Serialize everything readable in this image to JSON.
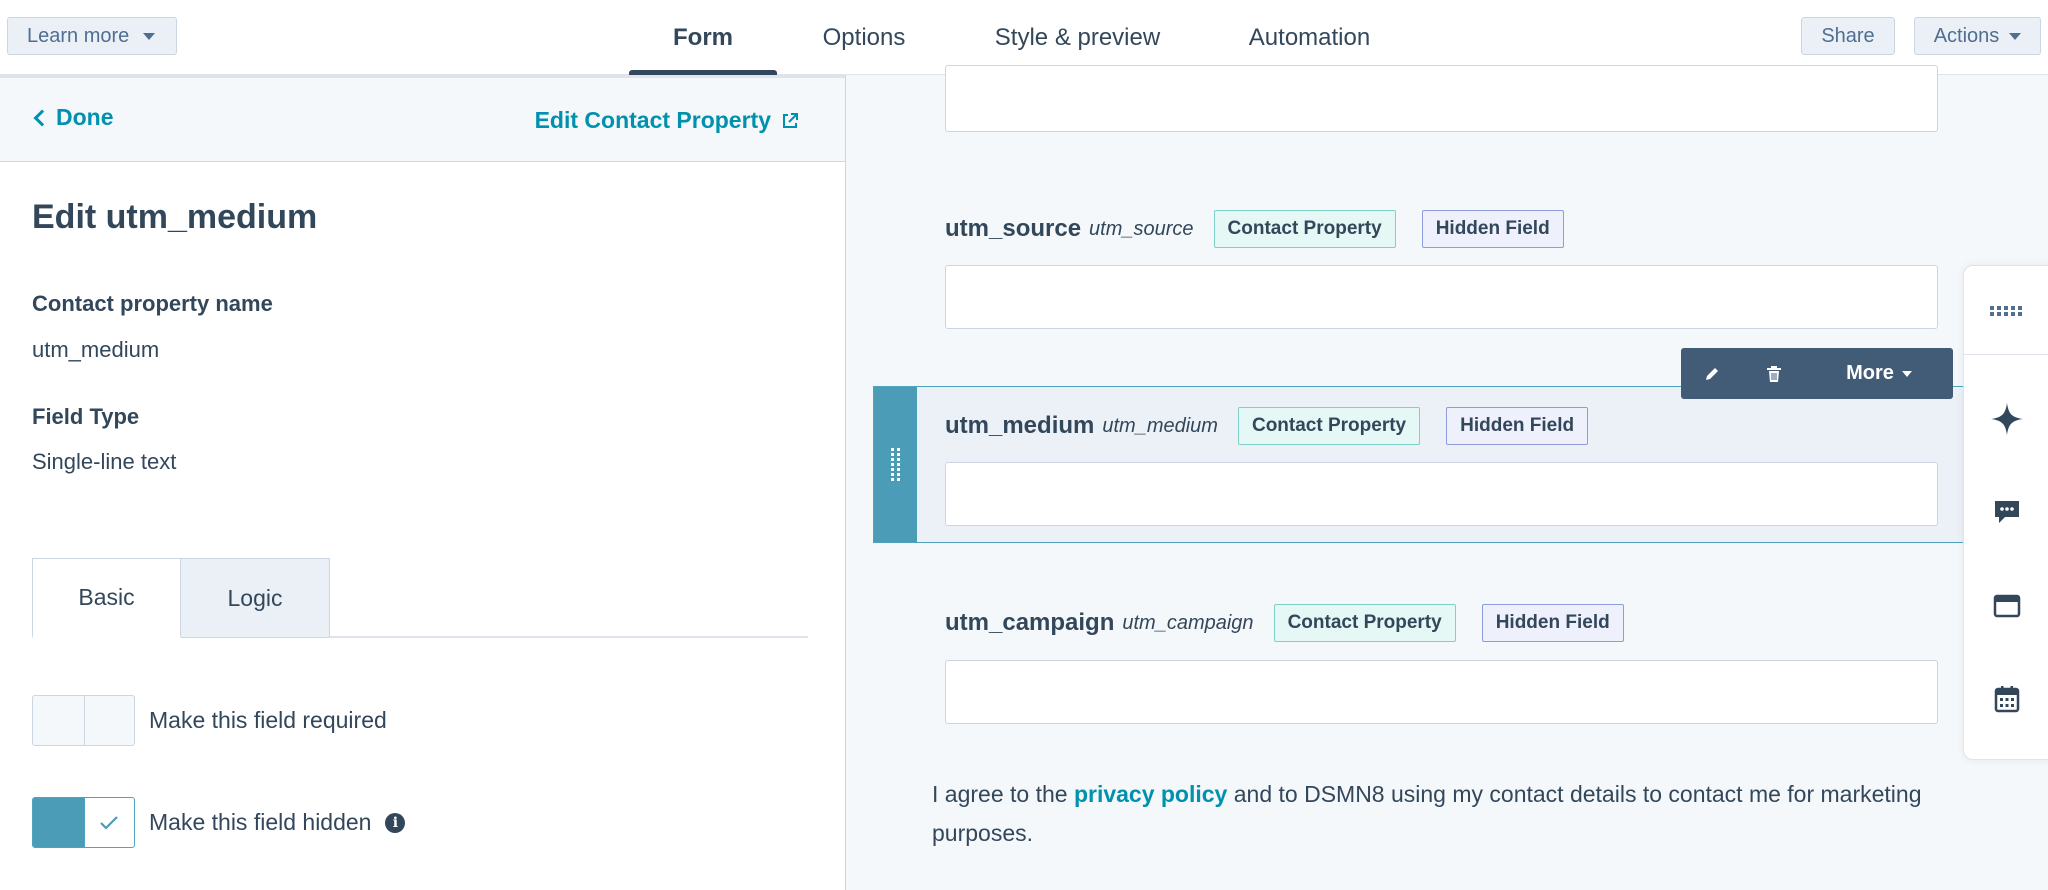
{
  "topbar": {
    "learn_more": "Learn more",
    "tabs": [
      "Form",
      "Options",
      "Style & preview",
      "Automation"
    ],
    "share": "Share",
    "actions": "Actions"
  },
  "panel": {
    "done": "Done",
    "edit_property_link": "Edit Contact Property",
    "title": "Edit utm_medium",
    "contact_property_name_label": "Contact property name",
    "contact_property_name_value": "utm_medium",
    "field_type_label": "Field Type",
    "field_type_value": "Single-line text",
    "tabs": {
      "basic": "Basic",
      "logic": "Logic"
    },
    "toggles": {
      "required_label": "Make this field required",
      "required_on": false,
      "hidden_label": "Make this field hidden",
      "hidden_on": true
    }
  },
  "preview": {
    "fields": [
      {
        "label": "utm_source",
        "internal": "utm_source",
        "badge_contact": "Contact Property",
        "badge_hidden": "Hidden Field"
      },
      {
        "label": "utm_medium",
        "internal": "utm_medium",
        "badge_contact": "Contact Property",
        "badge_hidden": "Hidden Field"
      },
      {
        "label": "utm_campaign",
        "internal": "utm_campaign",
        "badge_contact": "Contact Property",
        "badge_hidden": "Hidden Field"
      }
    ],
    "toolbar": {
      "more": "More"
    },
    "consent": {
      "before": "I agree to the ",
      "link": "privacy policy",
      "after": " and to DSMN8 using my contact details to contact me for marketing purposes."
    }
  },
  "icons": {
    "dock": [
      "grid-icon",
      "sparkle-icon",
      "chat-icon",
      "browser-window-icon",
      "calendar-icon"
    ]
  },
  "colors": {
    "accent_teal": "#0091ae",
    "selected_border": "#4fa3bd",
    "text_primary": "#33475b",
    "toolbar_bg": "#425b76"
  }
}
